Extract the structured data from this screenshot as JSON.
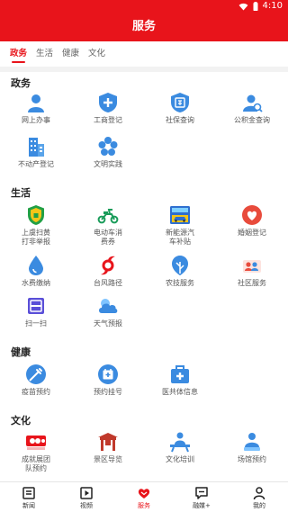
{
  "status": {
    "time": "4:10"
  },
  "header": {
    "title": "服务"
  },
  "tabs": [
    {
      "label": "政务",
      "active": true
    },
    {
      "label": "生活"
    },
    {
      "label": "健康"
    },
    {
      "label": "文化"
    }
  ],
  "sections": {
    "gov": {
      "title": "政务",
      "items": [
        {
          "label": "网上办事",
          "icon": "person-icon",
          "color": "#3b8be0"
        },
        {
          "label": "工商登记",
          "icon": "shield-plus-icon",
          "color": "#3b8be0"
        },
        {
          "label": "社保查询",
          "icon": "bao-badge-icon",
          "color": "#3b8be0"
        },
        {
          "label": "公积金查询",
          "icon": "search-person-icon",
          "color": "#3b8be0"
        },
        {
          "label": "不动产登记",
          "icon": "building-icon",
          "color": "#3b8be0"
        },
        {
          "label": "文明实践",
          "icon": "flower-icon",
          "color": "#3b8be0"
        }
      ]
    },
    "life": {
      "title": "生活",
      "items": [
        {
          "label": "上虞扫黄\n打非举报",
          "icon": "green-shield-icon",
          "color": "#22a045"
        },
        {
          "label": "电动车消\n费券",
          "icon": "scooter-icon",
          "color": "#1a9c5a"
        },
        {
          "label": "新能源汽\n车补贴",
          "icon": "new-energy-icon",
          "color": "#2f6fd0"
        },
        {
          "label": "婚姻登记",
          "icon": "heart-circle-icon",
          "color": "#e84b3c"
        },
        {
          "label": "水费缴纳",
          "icon": "water-drop-icon",
          "color": "#3b8be0"
        },
        {
          "label": "台风路径",
          "icon": "typhoon-icon",
          "color": "#e8141b"
        },
        {
          "label": "农技服务",
          "icon": "leaf-icon",
          "color": "#3b8be0"
        },
        {
          "label": "社区服务",
          "icon": "community-icon",
          "color": "#e84b3c"
        },
        {
          "label": "扫一扫",
          "icon": "scan-icon",
          "color": "#5a4fd8"
        },
        {
          "label": "天气预报",
          "icon": "cloud-icon",
          "color": "#3b8be0"
        }
      ]
    },
    "health": {
      "title": "健康",
      "items": [
        {
          "label": "疫苗预约",
          "icon": "syringe-icon",
          "color": "#3b8be0"
        },
        {
          "label": "预约挂号",
          "icon": "calendar-plus-icon",
          "color": "#3b8be0"
        },
        {
          "label": "医共体信息",
          "icon": "medkit-icon",
          "color": "#3b8be0"
        }
      ]
    },
    "culture": {
      "title": "文化",
      "items": [
        {
          "label": "成就展团\n队预约",
          "icon": "exhibition-logo-icon",
          "color": "#e8141b"
        },
        {
          "label": "景区导览",
          "icon": "gate-icon",
          "color": "#c0392b"
        },
        {
          "label": "文化培训",
          "icon": "lecture-icon",
          "color": "#3b8be0"
        },
        {
          "label": "场馆预约",
          "icon": "venue-person-icon",
          "color": "#3b8be0"
        }
      ]
    }
  },
  "tabbar": [
    {
      "label": "新闻",
      "icon": "news-icon"
    },
    {
      "label": "视频",
      "icon": "video-icon"
    },
    {
      "label": "服务",
      "icon": "service-icon",
      "active": true
    },
    {
      "label": "融媒+",
      "icon": "chat-icon"
    },
    {
      "label": "我的",
      "icon": "user-icon"
    }
  ],
  "colors": {
    "brand": "#e8141b",
    "icon_blue": "#3b8be0"
  }
}
